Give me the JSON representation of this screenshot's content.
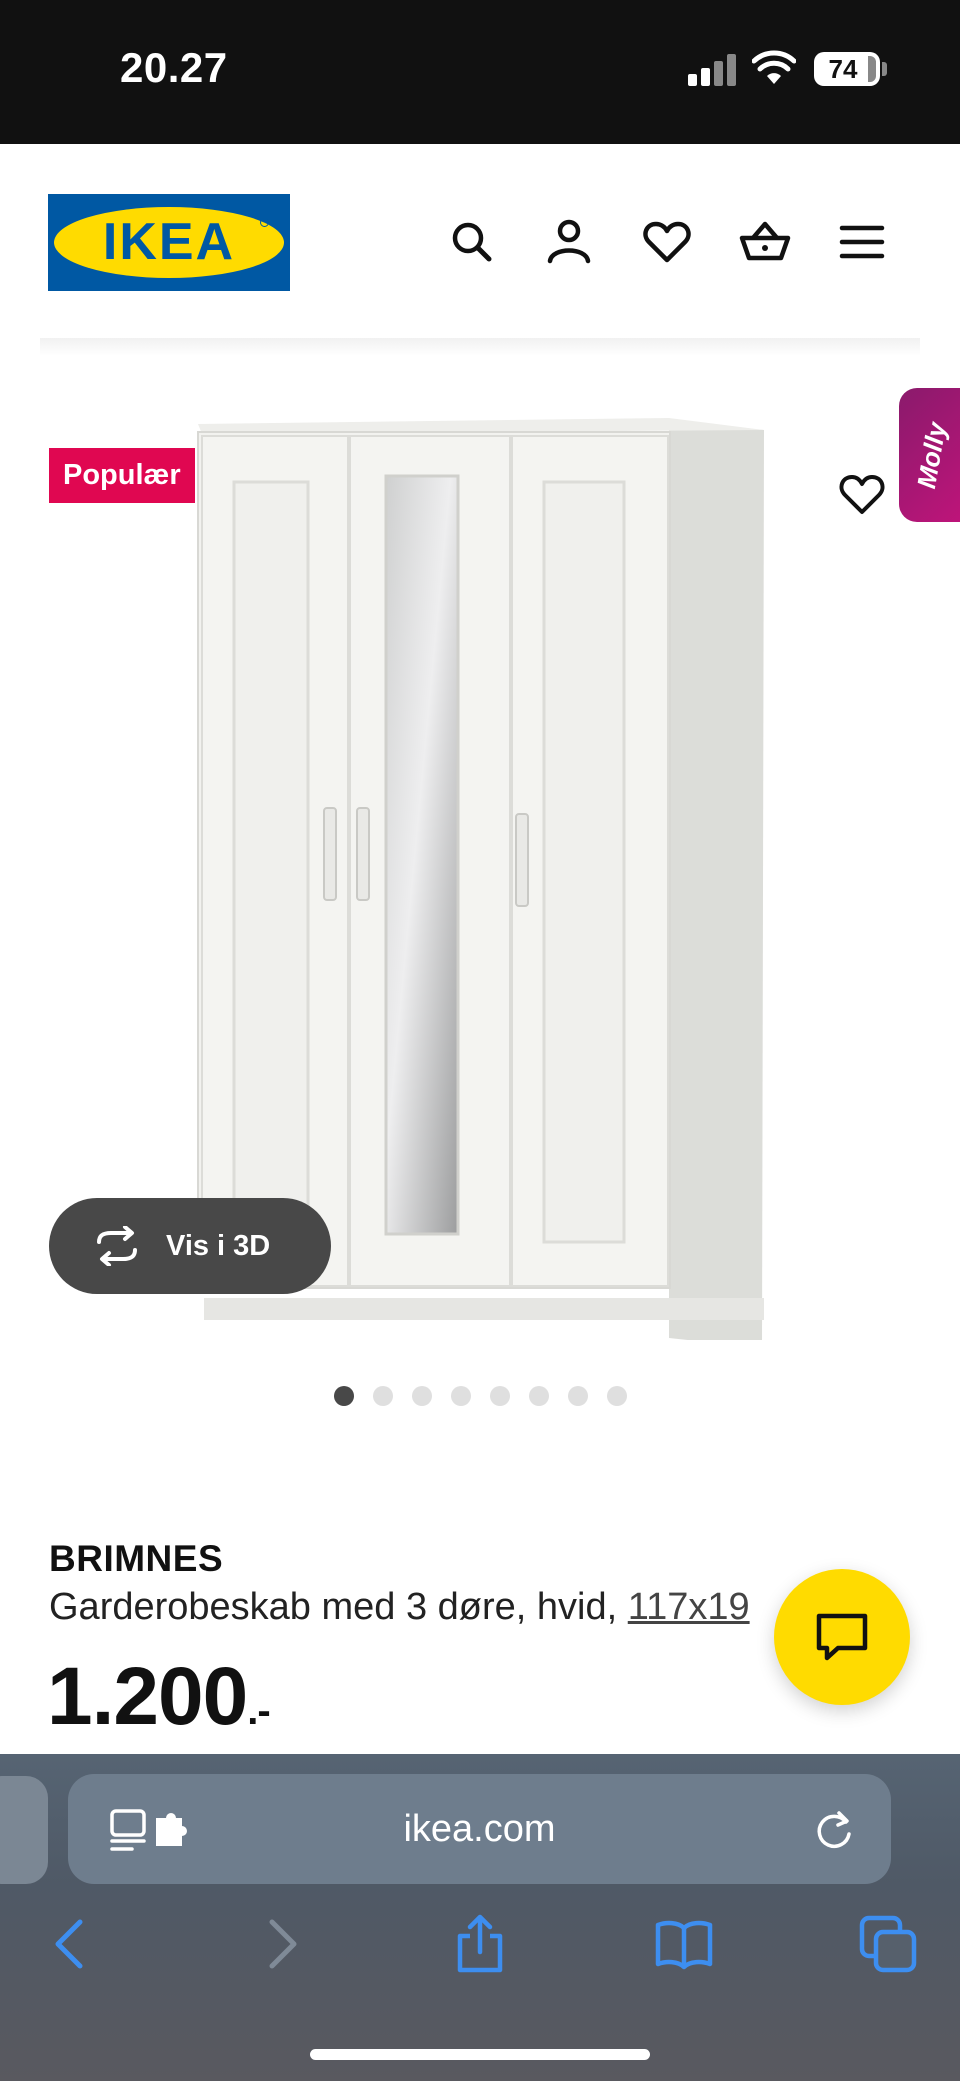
{
  "status_bar": {
    "time": "20.27",
    "battery": "74"
  },
  "header": {
    "logo_text": "IKEA",
    "icons": [
      "search-icon",
      "account-icon",
      "favourites-icon",
      "basket-icon",
      "menu-icon"
    ]
  },
  "gallery": {
    "badge": "Populær",
    "assistant_tab": "Molly",
    "view_3d_label": "Vis i 3D",
    "image_count": 8,
    "active_image_index": 0
  },
  "product": {
    "name": "BRIMNES",
    "description": "Garderobeskab med 3 døre, hvid, ",
    "size_link": "117x19",
    "price": "1.200",
    "price_suffix": ".-"
  },
  "browser": {
    "url_host": "ikea.com",
    "toolbar": [
      "back-icon",
      "forward-icon",
      "share-icon",
      "bookmarks-icon",
      "tabs-icon"
    ],
    "accent_color": "#3d8ef0"
  },
  "colors": {
    "brand_blue": "#0058a3",
    "brand_yellow": "#ffdb00",
    "badge_red": "#e00751"
  }
}
